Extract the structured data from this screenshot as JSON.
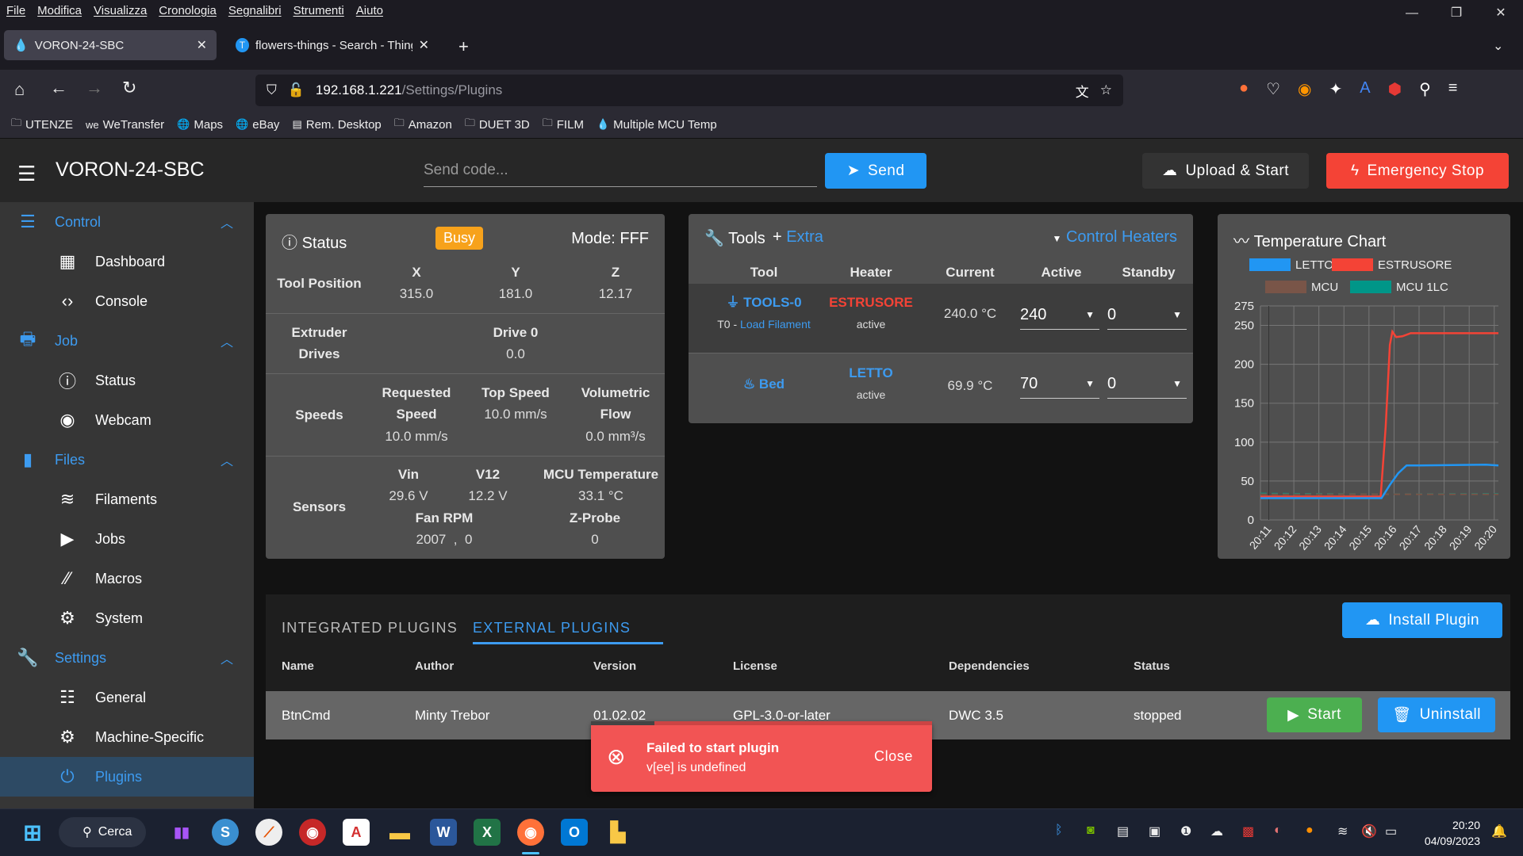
{
  "browser": {
    "menu": [
      "File",
      "Modifica",
      "Visualizza",
      "Cronologia",
      "Segnalibri",
      "Strumenti",
      "Aiuto"
    ],
    "tabs": [
      {
        "label": "VORON-24-SBC",
        "active": true
      },
      {
        "label": "flowers-things - Search - Thingi",
        "active": false
      }
    ],
    "url_host": "192.168.1.221",
    "url_path": "/Settings/Plugins",
    "bookmarks": [
      {
        "icon": "folder-icon",
        "label": "UTENZE"
      },
      {
        "icon": "wetransfer-icon",
        "label": "WeTransfer"
      },
      {
        "icon": "globe-icon",
        "label": "Maps"
      },
      {
        "icon": "globe-icon",
        "label": "eBay"
      },
      {
        "icon": "remote-desktop-icon",
        "label": "Rem. Desktop"
      },
      {
        "icon": "folder-icon",
        "label": "Amazon"
      },
      {
        "icon": "folder-icon",
        "label": "DUET 3D"
      },
      {
        "icon": "folder-icon",
        "label": "FILM"
      },
      {
        "icon": "duet-drop-icon",
        "label": "Multiple MCU Temp"
      }
    ]
  },
  "header": {
    "title": "VORON-24-SBC",
    "send_placeholder": "Send code...",
    "send_label": "Send",
    "upload_label": "Upload & Start",
    "estop_label": "Emergency Stop"
  },
  "sidebar": {
    "items": [
      {
        "label": "Control",
        "type": "group",
        "icon": "tune-icon",
        "glyph": "☰"
      },
      {
        "label": "Dashboard",
        "type": "sub",
        "icon": "dashboard-icon",
        "glyph": "▦"
      },
      {
        "label": "Console",
        "type": "sub",
        "icon": "code-icon",
        "glyph": "‹›"
      },
      {
        "label": "Job",
        "type": "group",
        "icon": "printer-icon",
        "glyph": "🖶"
      },
      {
        "label": "Status",
        "type": "sub",
        "icon": "info-icon",
        "glyph": "ⓘ"
      },
      {
        "label": "Webcam",
        "type": "sub",
        "icon": "webcam-icon",
        "glyph": "◉"
      },
      {
        "label": "Files",
        "type": "group",
        "icon": "sd-card-icon",
        "glyph": "▮"
      },
      {
        "label": "Filaments",
        "type": "sub",
        "icon": "database-icon",
        "glyph": "≋"
      },
      {
        "label": "Jobs",
        "type": "sub",
        "icon": "play-icon",
        "glyph": "▶"
      },
      {
        "label": "Macros",
        "type": "sub",
        "icon": "macro-icon",
        "glyph": "⁄⁄"
      },
      {
        "label": "System",
        "type": "sub",
        "icon": "gear-icon",
        "glyph": "⚙"
      },
      {
        "label": "Settings",
        "type": "group",
        "icon": "wrench-icon",
        "glyph": "🔧"
      },
      {
        "label": "General",
        "type": "sub",
        "icon": "sliders-icon",
        "glyph": "☷"
      },
      {
        "label": "Machine-Specific",
        "type": "sub",
        "icon": "cogs-icon",
        "glyph": "⚙"
      },
      {
        "label": "Plugins",
        "type": "sub",
        "icon": "plug-icon",
        "glyph": "⏻",
        "selected": true
      }
    ]
  },
  "status": {
    "title": "Status",
    "badge": "Busy",
    "badge_color": "#f7a21b",
    "mode": "Mode: FFF",
    "tool_position_label": "Tool Position",
    "axes": [
      {
        "name": "X",
        "value": "315.0"
      },
      {
        "name": "Y",
        "value": "181.0"
      },
      {
        "name": "Z",
        "value": "12.17"
      }
    ],
    "extruder_label_1": "Extruder",
    "extruder_label_2": "Drives",
    "drive_name": "Drive 0",
    "drive_value": "0.0",
    "speeds_label": "Speeds",
    "requested_1": "Requested",
    "requested_2": "Speed",
    "requested_value": "10.0 mm/s",
    "top_speed": "Top Speed",
    "top_speed_value": "10.0 mm/s",
    "vol_1": "Volumetric",
    "vol_2": "Flow",
    "vol_value": "0.0 mm³/s",
    "sensors_label": "Sensors",
    "vin": "Vin",
    "vin_value": "29.6 V",
    "v12": "V12",
    "v12_value": "12.2 V",
    "mcu_temp": "MCU Temperature",
    "mcu_temp_value": "33.1 °C",
    "fan_rpm": "Fan RPM",
    "fan_rpm_value": "2007  ,  0",
    "zprobe": "Z-Probe",
    "zprobe_value": "0"
  },
  "tools": {
    "title": "Tools",
    "extra": "Extra",
    "control_heaters": "Control Heaters",
    "columns": [
      "Tool",
      "Heater",
      "Current",
      "Active",
      "Standby"
    ],
    "rows": [
      {
        "tool": "TOOLS-0",
        "sub_prefix": "T0 - ",
        "sub_link": "Load Filament",
        "heater": "ESTRUSORE",
        "heater_color": "#f44336",
        "heater_state": "active",
        "current": "240.0 °C",
        "active": "240",
        "standby": "0"
      },
      {
        "tool": "Bed",
        "heater": "LETTO",
        "heater_color": "#3d9bf0",
        "heater_state": "active",
        "current": "69.9 °C",
        "active": "70",
        "standby": "0"
      }
    ]
  },
  "chart_data": {
    "type": "line",
    "title": "Temperature Chart",
    "ylim": [
      0,
      275
    ],
    "yticks": [
      0,
      50,
      100,
      150,
      200,
      250,
      275
    ],
    "xticks": [
      "20:11",
      "20:12",
      "20:13",
      "20:14",
      "20:15",
      "20:16",
      "20:17",
      "20:18",
      "20:19",
      "20:20"
    ],
    "xlim": [
      "20:10:40",
      "20:20:10"
    ],
    "grid": true,
    "legend": "top",
    "series": [
      {
        "name": "LETTO",
        "color": "#2196f3",
        "dashed": false,
        "points": [
          [
            "20:10:40",
            28
          ],
          [
            "20:15:30",
            28
          ],
          [
            "20:15:50",
            45
          ],
          [
            "20:16:10",
            60
          ],
          [
            "20:16:30",
            70
          ],
          [
            "20:17:00",
            70
          ],
          [
            "20:19:40",
            71
          ],
          [
            "20:20:10",
            70
          ]
        ]
      },
      {
        "name": "ESTRUSORE",
        "color": "#f44336",
        "dashed": false,
        "points": [
          [
            "20:10:40",
            30
          ],
          [
            "20:15:28",
            30
          ],
          [
            "20:15:40",
            120
          ],
          [
            "20:15:50",
            225
          ],
          [
            "20:15:56",
            242
          ],
          [
            "20:16:05",
            235
          ],
          [
            "20:16:20",
            236
          ],
          [
            "20:16:40",
            240
          ],
          [
            "20:20:10",
            240
          ]
        ]
      },
      {
        "name": "MCU",
        "color": "#795548",
        "dashed": true,
        "points": [
          [
            "20:10:40",
            33
          ],
          [
            "20:20:10",
            33
          ]
        ]
      },
      {
        "name": "MCU 1LC",
        "color": "#009688",
        "dashed": true,
        "points": [
          [
            "20:10:40",
            34
          ],
          [
            "20:15:20",
            33
          ],
          [
            "20:20:10",
            33.5
          ]
        ]
      }
    ]
  },
  "plugins": {
    "tabs": [
      "INTEGRATED PLUGINS",
      "EXTERNAL PLUGINS"
    ],
    "active_tab": 1,
    "install_label": "Install Plugin",
    "columns": [
      "Name",
      "Author",
      "Version",
      "License",
      "Dependencies",
      "Status"
    ],
    "rows": [
      {
        "name": "BtnCmd",
        "author": "Minty Trebor",
        "version": "01.02.02",
        "license": "GPL-3.0-or-later",
        "dependencies": "DWC 3.5",
        "status": "stopped"
      }
    ],
    "start_label": "Start",
    "uninstall_label": "Uninstall"
  },
  "toast": {
    "title": "Failed to start plugin",
    "message": "v[ee] is undefined",
    "close_label": "Close"
  },
  "taskbar": {
    "search_label": "Cerca",
    "time": "20:20",
    "date": "04/09/2023"
  }
}
